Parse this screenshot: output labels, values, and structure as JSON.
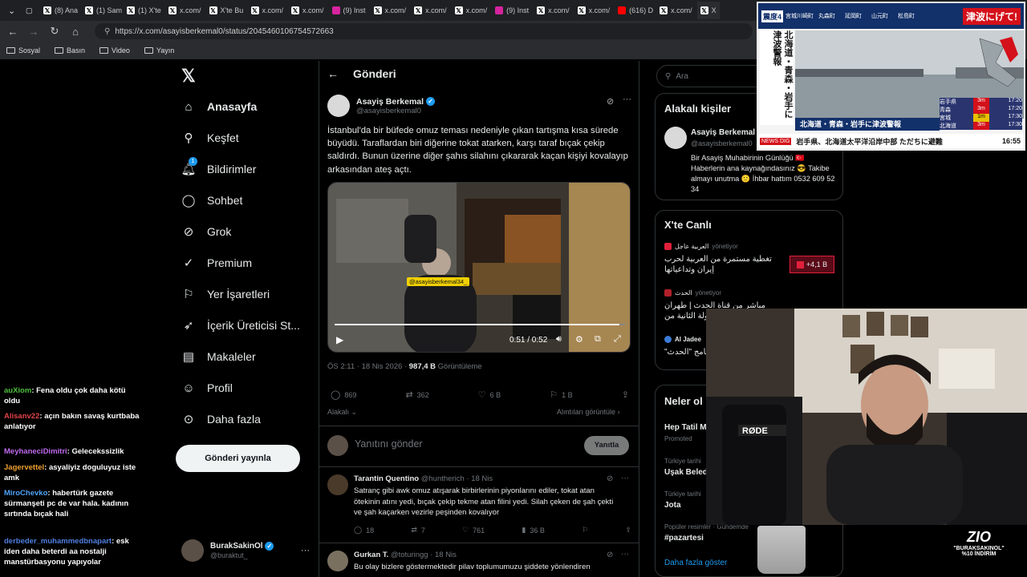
{
  "browser": {
    "tabs": [
      "(8) Ana",
      "(1) Sam",
      "(1) X'te",
      "x.com/",
      "X'te Bu",
      "x.com/",
      "x.com/",
      "(9) Inst",
      "x.com/",
      "x.com/",
      "x.com/",
      "(9) Inst",
      "x.com/",
      "x.com/",
      "(616) D",
      "x.com/",
      "X"
    ],
    "url": "https://x.com/asayisberkemal0/status/2045460106754572663",
    "bookmarks": [
      "Sosyal",
      "Basın",
      "Video",
      "Yayın"
    ]
  },
  "nav": {
    "items": [
      "Anasayfa",
      "Keşfet",
      "Bildirimler",
      "Sohbet",
      "Grok",
      "Premium",
      "Yer İşaretleri",
      "İçerik Üreticisi St...",
      "Makaleler",
      "Profil",
      "Daha fazla"
    ],
    "notif_badge": "1",
    "post_button": "Gönderi yayınla",
    "account": {
      "name": "BurakSakinOl",
      "handle": "@buraktut_"
    }
  },
  "post": {
    "header": "Gönderi",
    "author": "Asayiş Berkemal",
    "handle": "@asayisberkemal0",
    "text": "İstanbul'da bir büfede omuz teması nedeniyle çıkan tartışma kısa sürede büyüdü. Taraflardan biri diğerine tokat atarken, karşı taraf bıçak çekip saldırdı. Bunun üzerine diğer şahıs silahını çıkararak kaçan kişiyi kovalayıp arkasından ateş açtı.",
    "video_watermark": "@asayisberkemal34_",
    "video_time": "0:51 / 0:52",
    "video_progress": 0.98,
    "timestamp": "ÖS 2:11 · 18 Nis 2026 · ",
    "views": "987,4 B",
    "views_label": "Görüntüleme",
    "replies": "869",
    "reposts": "362",
    "likes": "6 B",
    "bookmarks": "1 B",
    "relevance": "Alakalı",
    "quotes": "Alıntıları görüntüle",
    "reply_placeholder": "Yanıtını gönder",
    "reply_button": "Yanıtla"
  },
  "replies": [
    {
      "name": "Tarantin Quentino",
      "handle": "@huntherich · 18 Nis",
      "text": "Satranç gibi awk omuz atışarak birbirlerinin piyonlarını ediler, tokat atan ötekinin atını yedi, bıçak çekip tekme atan filini yedi. Silah çeken de şah çekti ve şah kaçarken vezirle peşinden kovalıyor",
      "replies": "18",
      "reposts": "7",
      "likes": "761",
      "views": "36 B"
    },
    {
      "name": "Gurkan T.",
      "handle": "@toturingg · 18 Nis",
      "text": "Bu olay bizlere göstermektedir pilav toplumumuzu şiddete yönlendiren"
    }
  ],
  "right": {
    "search_placeholder": "Ara",
    "relevant_title": "Alakalı kişiler",
    "relevant_name": "Asayiş Berkemal",
    "relevant_handle": "@asayisberkemal0",
    "relevant_bio": "Bir Asayiş Muhabirinin Günlüğü 🇹🇷 Haberlerin ana kaynağındasınız 😎 Takibe almayı unutma 🙂 İhbar hattım 0532 609 52 34",
    "live_title": "X'te Canlı",
    "live1_host": "العربية عاجل",
    "live1_role": "yönetiyor",
    "live1_text": "تغطية مستمرة من العربية لحرب إيران وتداعياتها",
    "live1_count": "+4,1 B",
    "live2_host": "الحدث",
    "live2_role": "yönetiyor",
    "live2_text": "مباشر من قناة الحدث | طهران ترفض الجولة الثانية من",
    "live3_host": "Al Jadee",
    "live3_text": "جديدة من برنامج \"الحدث\"",
    "trends_title": "Neler ol",
    "trend1": "Hep Tatil M",
    "trend1_meta": "Promoted",
    "trend2_meta": "Türkiye tarihi",
    "trend2": "Uşak Beled",
    "trend3_meta": "Türkiye tarihi",
    "trend3": "Jota",
    "trend4_meta": "Popüler resimler · Gündemde",
    "trend4": "#pazartesi",
    "show_more": "Daha fazla göster"
  },
  "chat": [
    {
      "user": "auXiom",
      "msg": "Fena oldu çok daha kötü oldu",
      "color": "#4fbf3f"
    },
    {
      "user": "Alisanv22",
      "msg": "açın bakın savaş kurtbaba anlatıyor",
      "color": "#e0434b"
    },
    {
      "user": "MeyhaneciDimitri",
      "msg": "Gelecekssizlik",
      "color": "#c06bf0"
    },
    {
      "user": "Jagervettel",
      "msg": "asyaliyiz doguluyuz iste amk",
      "color": "#f0a030"
    },
    {
      "user": "MiroChevko",
      "msg": "habertürk gazete sürmanşeti pc de var hala. kadının sırtında bıçak hali",
      "color": "#4fa3f7"
    },
    {
      "user": "derbeder_muhammedbnapart",
      "msg": "esk iden daha beterdi aa nostalji manstürbasyonu yapıyolar",
      "color": "#4f7fe0"
    }
  ],
  "tv": {
    "prefectures": [
      "宮城川崎町",
      "丸森町",
      "延岡町",
      "山元町",
      "松島町"
    ],
    "warning": "津波にげて!",
    "side_text": "北海道・青森・岩手に津波警報",
    "banner": "北海道・青森・岩手に津波警報",
    "ticker": "岩手県、北海道太平洋沿岸中部 ただちに避難",
    "clock": "16:55",
    "channel": "NEWS DIG",
    "table": [
      [
        "岩手県",
        "3m",
        "17:20"
      ],
      [
        "青森",
        "3m",
        "17:20"
      ],
      [
        "宮城",
        "1m",
        "17:30"
      ],
      [
        "北海道",
        "3m",
        "17:30"
      ]
    ]
  },
  "promo": {
    "brand": "ZIO",
    "code": "\"BURAKSAKINOL\"",
    "discount": "%10 İNDİRİM"
  }
}
